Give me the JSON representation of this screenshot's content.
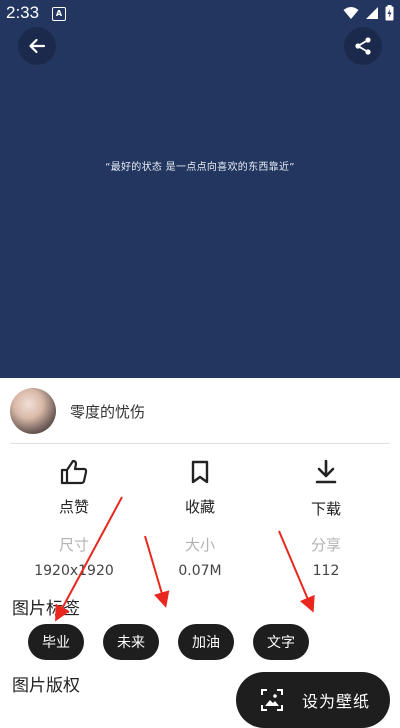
{
  "status_bar": {
    "time": "2:33",
    "notification_letter": "A"
  },
  "wallpaper": {
    "quote": "“最好的状态 是一点点向喜欢的东西靠近”",
    "background_color": "#23365f"
  },
  "author": {
    "name": "零度的忧伤"
  },
  "actions": [
    {
      "name": "like",
      "label": "点赞",
      "icon": "thumbs-up-icon"
    },
    {
      "name": "favorite",
      "label": "收藏",
      "icon": "bookmark-icon"
    },
    {
      "name": "download",
      "label": "下载",
      "icon": "download-icon"
    }
  ],
  "stats": [
    {
      "key": "尺寸",
      "value": "1920x1920"
    },
    {
      "key": "大小",
      "value": "0.07M"
    },
    {
      "key": "分享",
      "value": "112"
    }
  ],
  "tags_section": {
    "title": "图片标签",
    "tags": [
      "毕业",
      "未来",
      "加油",
      "文字"
    ]
  },
  "copyright_section": {
    "title": "图片版权"
  },
  "set_wallpaper": {
    "label": "设为壁纸",
    "icon": "wallpaper-icon"
  },
  "colors": {
    "accent_dark": "#1e1e1e",
    "arrow": "#e8281e"
  }
}
